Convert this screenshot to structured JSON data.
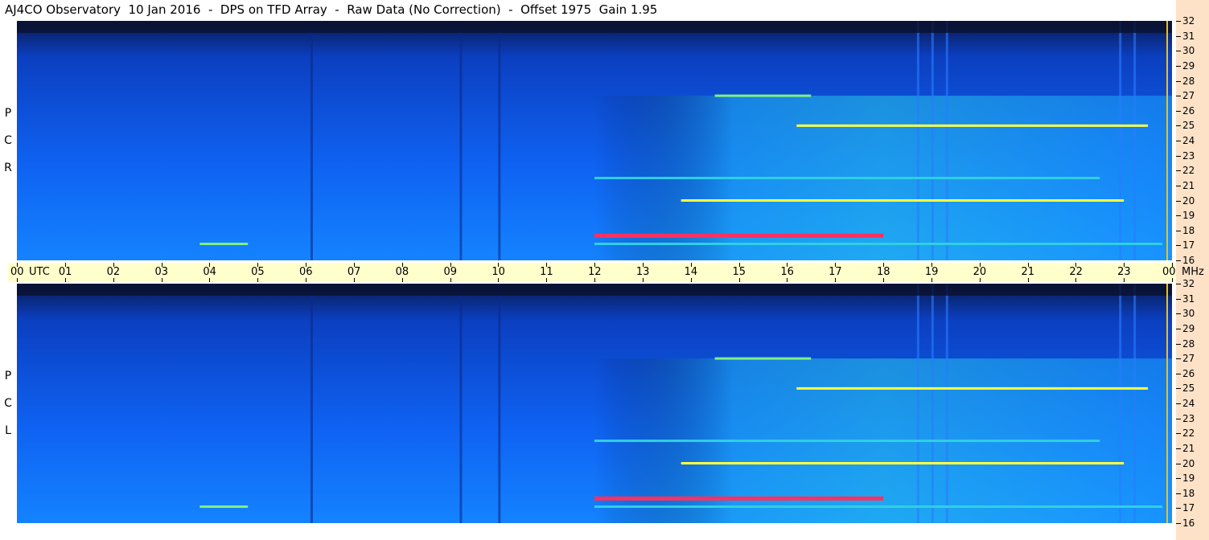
{
  "title": "AJ4CO Observatory  10 Jan 2016  -  DPS on TFD Array  -  Raw Data (No Correction)  -  Offset 1975  Gain 1.95",
  "chart_data": {
    "type": "heatmap",
    "title": "AJ4CO Observatory  10 Jan 2016  -  DPS on TFD Array  -  Raw Data (No Correction)  -  Offset 1975  Gain 1.95",
    "x_unit_label": "UTC",
    "y_unit_label": "MHz",
    "x_ticks": [
      "00",
      "01",
      "02",
      "03",
      "04",
      "05",
      "06",
      "07",
      "08",
      "09",
      "10",
      "11",
      "12",
      "13",
      "14",
      "15",
      "16",
      "17",
      "18",
      "19",
      "20",
      "21",
      "22",
      "23",
      "00"
    ],
    "y_ticks": [
      "32",
      "31",
      "30",
      "29",
      "28",
      "27",
      "26",
      "25",
      "24",
      "23",
      "22",
      "21",
      "20",
      "19",
      "18",
      "17",
      "16"
    ],
    "xlim_utc_hours": [
      0,
      24
    ],
    "ylim_mhz": [
      16,
      32
    ],
    "panels": [
      {
        "name": "RCP",
        "label_letters": [
          "R",
          "C",
          "P"
        ]
      },
      {
        "name": "LCP",
        "label_letters": [
          "L",
          "C",
          "P"
        ]
      }
    ],
    "colormap": [
      "#0a1030",
      "#0a2a8a",
      "#0f5fef",
      "#1a8fff",
      "#30d0e0",
      "#7ff080",
      "#ffff40",
      "#ff3060"
    ],
    "features": [
      {
        "kind": "band",
        "mhz": 27,
        "utc_start": 14.5,
        "utc_end": 16.5,
        "level": 0.7
      },
      {
        "kind": "band",
        "mhz": 17.7,
        "utc_start": 12.0,
        "utc_end": 18.0,
        "level": 0.95
      },
      {
        "kind": "band",
        "mhz": 21.5,
        "utc_start": 12.0,
        "utc_end": 22.5,
        "level": 0.6
      },
      {
        "kind": "band",
        "mhz": 20.0,
        "utc_start": 13.8,
        "utc_end": 23.0,
        "level": 0.85
      },
      {
        "kind": "band",
        "mhz": 25.0,
        "utc_start": 16.2,
        "utc_end": 23.5,
        "level": 0.8
      },
      {
        "kind": "band",
        "mhz": 17.1,
        "utc_start": 12.0,
        "utc_end": 23.8,
        "level": 0.55
      },
      {
        "kind": "band",
        "mhz": 17.1,
        "utc_start": 3.8,
        "utc_end": 4.8,
        "level": 0.7
      },
      {
        "kind": "dark_top",
        "utc_start": 0.0,
        "utc_end": 24.0,
        "level": 0.2
      }
    ],
    "grid": false
  },
  "colors": {
    "time_bar_bg": "#ffffcc",
    "freq_bar_bg": "#fde2c8",
    "cursor": "#f2c200"
  }
}
